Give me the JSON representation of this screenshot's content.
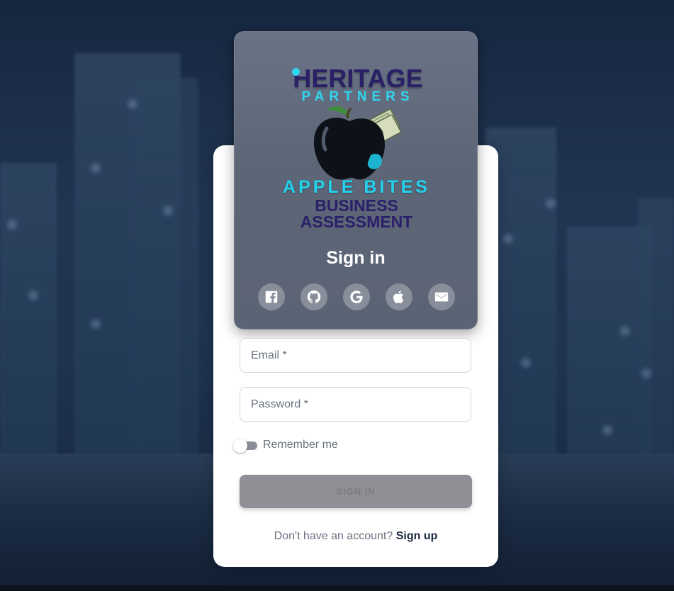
{
  "logo": {
    "heritage": "HERITAGE",
    "partners": "PARTNERS",
    "apple_bites": "APPLE BITES",
    "business": "BUSINESS",
    "assessment": "ASSESSMENT"
  },
  "title": "Sign in",
  "social_buttons": [
    "facebook-icon",
    "github-icon",
    "google-icon",
    "apple-icon",
    "email-icon"
  ],
  "form": {
    "email_placeholder": "Email *",
    "password_placeholder": "Password *",
    "remember_label": "Remember me",
    "remember_checked": false,
    "submit_label": "SIGN IN"
  },
  "footer": {
    "prompt": "Don't have an account?",
    "signup_link": "Sign up"
  },
  "colors": {
    "accent_cyan": "#2fd7ef",
    "logo_navy": "#2a1f6a",
    "button_disabled": "#8f9096"
  }
}
